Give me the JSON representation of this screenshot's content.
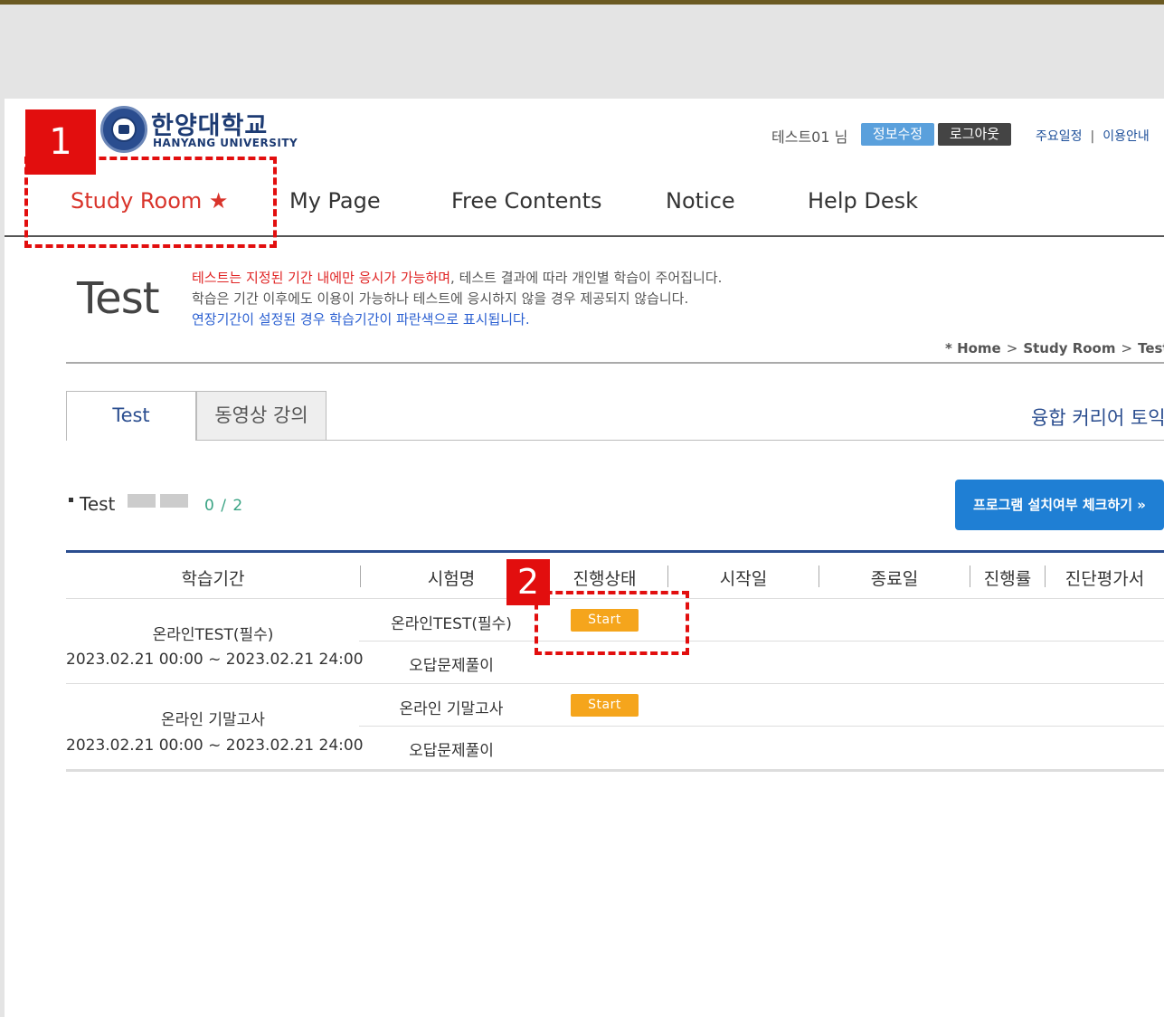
{
  "header": {
    "logo_korean": "한양대학교",
    "logo_english": "HANYANG UNIVERSITY",
    "user_greeting": "테스트01 님",
    "edit_profile_label": "정보수정",
    "logout_label": "로그아웃",
    "util_link_schedule": "주요일정",
    "util_separator": "|",
    "util_link_guide": "이용안내"
  },
  "nav": {
    "items": [
      {
        "label": "Study Room ★",
        "active": true
      },
      {
        "label": "My Page"
      },
      {
        "label": "Free Contents"
      },
      {
        "label": "Notice"
      },
      {
        "label": "Help Desk"
      }
    ]
  },
  "page": {
    "title": "Test",
    "desc_red": "테스트는 지정된 기간 내에만 응시가 가능하며",
    "desc_rest": ", 테스트 결과에 따라 개인별 학습이 주어집니다.",
    "desc_line2": "학습은 기간 이후에도 이용이 가능하나 테스트에 응시하지 않을 경우 제공되지 않습니다.",
    "desc_line3": "연장기간이 설정된 경우 학습기간이 파란색으로 표시됩니다.",
    "breadcrumb": [
      "* Home",
      "Study Room",
      "Test"
    ],
    "breadcrumb_sep": ">"
  },
  "tabs": {
    "active": "Test",
    "inactive": "동영상 강의",
    "course_name": "융합 커리어 토익"
  },
  "section": {
    "title": "Test",
    "progress": "0 / 2",
    "check_button": "프로그램 설치여부 체크하기 »"
  },
  "table": {
    "headers": [
      "학습기간",
      "시험명",
      "진행상태",
      "시작일",
      "종료일",
      "진행률",
      "진단평가서"
    ],
    "rows": [
      {
        "group_title": "온라인TEST(필수)",
        "period": "2023.02.21 00:00 ~ 2023.02.21 24:00",
        "exam_name": "온라인TEST(필수)",
        "status_button": "Start",
        "review": "오답문제풀이"
      },
      {
        "group_title": "온라인 기말고사",
        "period": "2023.02.21 00:00 ~ 2023.02.21 24:00",
        "exam_name": "온라인 기말고사",
        "status_button": "Start",
        "review": "오답문제풀이"
      }
    ]
  },
  "annotations": {
    "step1": "1",
    "step2": "2"
  },
  "colors": {
    "accent_red": "#e20e0e",
    "nav_active": "#d9342b",
    "brand_blue": "#2a4d8f",
    "start_orange": "#f5a51c",
    "check_blue": "#1f7fd4"
  }
}
